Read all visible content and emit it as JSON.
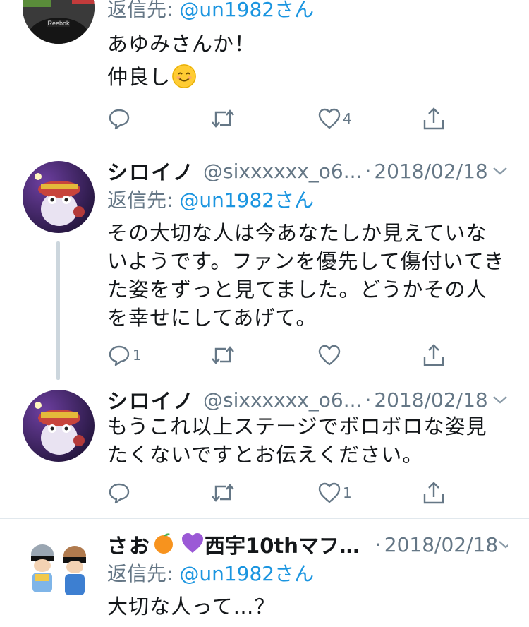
{
  "tweet1": {
    "reply_prefix": "返信先: ",
    "reply_mention": "@un1982さん",
    "line1": "あゆみさんか！",
    "line2": "仲良し",
    "like_count": "4"
  },
  "tweet2": {
    "name": "シロイノ",
    "handle": "@sixxxxxx_o6...",
    "dot": "·",
    "date": "2018/02/18",
    "reply_prefix": "返信先: ",
    "reply_mention": "@un1982さん",
    "lines": [
      "その大切な人は今あなたしか見えていな",
      "いようです。ファンを優先して傷付いてき",
      "た姿をずっと見てました。どうかその人",
      "を幸せにしてあげて。"
    ],
    "reply_count": "1"
  },
  "tweet3": {
    "name": "シロイノ",
    "handle": "@sixxxxxx_o6...",
    "dot": "·",
    "date": "2018/02/18",
    "lines": [
      "もうこれ以上ステージでボロボロな姿見",
      "たくないですとお伝えください。"
    ],
    "like_count": "1"
  },
  "tweet4": {
    "name_part1": "さお",
    "name_part2": "西宇10thマフ…",
    "dot": "·",
    "date": "2018/02/18",
    "reply_prefix": "返信先: ",
    "reply_mention": "@un1982さん",
    "line1": "大切な人って…？"
  },
  "colors": {
    "link": "#1b95e0",
    "secondary": "#657786",
    "divider": "#e1e8ed"
  }
}
